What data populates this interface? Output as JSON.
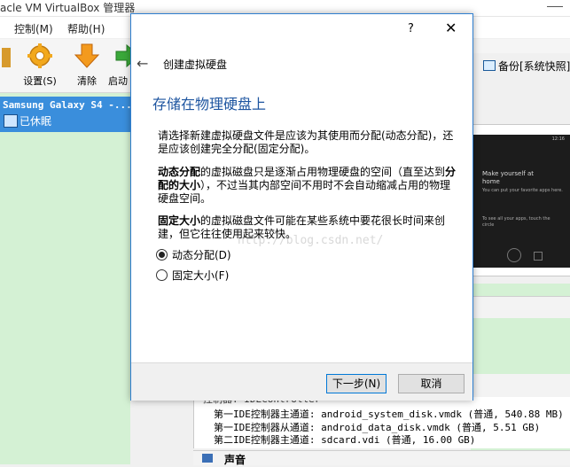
{
  "app": {
    "window_title": "acle VM VirtualBox 管理器",
    "menu": [
      "控制(M)",
      "帮助(H)"
    ],
    "toolbar": [
      {
        "label": "设置(S)",
        "icon": "gear-icon"
      },
      {
        "label": "清除",
        "icon": "arrow-down-icon"
      },
      {
        "label": "启动",
        "icon": "arrow-right-icon"
      }
    ],
    "snapshot_button": "备份[系统快照]",
    "vm": {
      "name": "Samsung Galaxy S4 -...",
      "state": "已休眠"
    },
    "preview": {
      "line1": "Make yourself at",
      "line2": "home",
      "line3": "You can put your favorite apps here.",
      "line4": "To see all your apps, touch the",
      "line5": "circle",
      "time": "12:16"
    },
    "storage": {
      "controller": "控制器: IDEController",
      "rows": [
        "第一IDE控制器主通道: android_system_disk.vmdk (普通, 540.88 MB)",
        "第一IDE控制器从通道: android_data_disk.vmdk (普通, 5.51 GB)",
        "第二IDE控制器主通道: sdcard.vdi (普通, 16.00 GB)"
      ]
    },
    "audio_section": "声音"
  },
  "dialog": {
    "help": "?",
    "close": "✕",
    "back": "←",
    "title": "创建虚拟硬盘",
    "heading": "存储在物理硬盘上",
    "para1": "请选择新建虚拟硬盘文件是应该为其使用而分配(动态分配)，还是应该创建完全分配(固定分配)。",
    "para2_bold1": "动态分配",
    "para2_mid": "的虚拟磁盘只是逐渐占用物理硬盘的空间（直至达到",
    "para2_bold2": "分配的大小",
    "para2_end": "），不过当其内部空间不用时不会自动缩减占用的物理硬盘空间。",
    "para3_bold": "固定大小",
    "para3_rest": "的虚拟磁盘文件可能在某些系统中要花很长时间来创建，但它往往使用起来较快。",
    "options": [
      {
        "label": "动态分配(D)",
        "checked": true
      },
      {
        "label": "固定大小(F)",
        "checked": false
      }
    ],
    "watermark": "http://blog.csdn.net/",
    "next_button": "下一步(N)",
    "cancel_button": "取消"
  }
}
